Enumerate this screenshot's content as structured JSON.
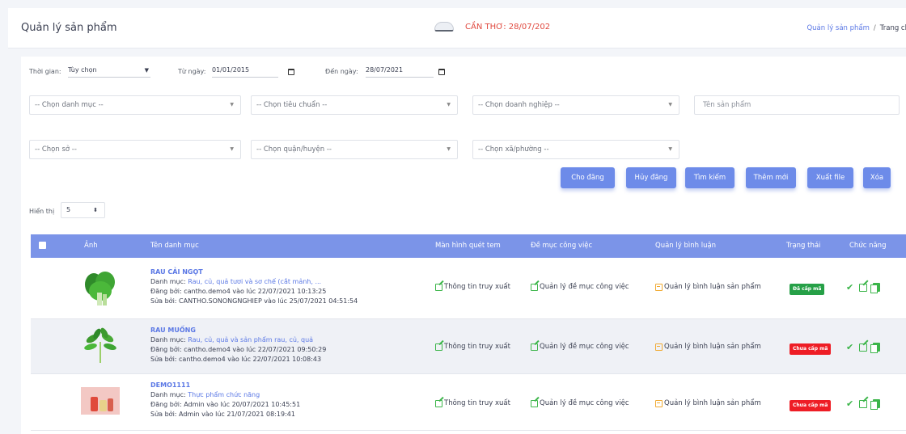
{
  "header": {
    "title": "Quản lý sản phẩm",
    "weather": "CẦN THƠ: 28/07/202",
    "breadcrumb": {
      "current": "Quản lý sản phẩm",
      "separator": "/",
      "home": "Trang ch"
    }
  },
  "filters": {
    "time_label": "Thời gian:",
    "time_value": "Tùy chọn",
    "from_label": "Từ ngày:",
    "from_value": "01/01/2015",
    "to_label": "Đến ngày:",
    "to_value": "28/07/2021",
    "category": "-- Chọn danh mục --",
    "standard": "-- Chọn tiêu chuẩn --",
    "enterprise": "-- Chọn doanh nghiệp --",
    "product_name_placeholder": "Tên sản phẩm",
    "department": "-- Chọn sở --",
    "district": "-- Chọn quận/huyện --",
    "ward": "-- Chọn xã/phường --"
  },
  "actions": {
    "publish": "Cho đăng",
    "unpublish": "Hủy đăng",
    "search": "Tìm kiếm",
    "add": "Thêm mới",
    "export": "Xuất file",
    "delete": "Xóa"
  },
  "pagination": {
    "show_label": "Hiển thị",
    "page_size": "5"
  },
  "table": {
    "columns": [
      "Ảnh",
      "Tên danh mục",
      "Màn hình quét tem",
      "Đề mục công việc",
      "Quản lý bình luận",
      "Trạng thái",
      "Chức năng"
    ],
    "rows": [
      {
        "name": "RAU CẢI NGỌT",
        "category_label": "Danh mục:",
        "category": "Rau, củ, quả tươi và sơ chế (cắt mảnh, ...",
        "posted": "Đăng bởi: cantho.demo4 vào lúc 22/07/2021 10:13:25",
        "edited": "Sửa bởi: CANTHO.SONONGNGHIEP vào lúc 25/07/2021 04:51:54",
        "scan": "Thông tin truy xuất",
        "task": "Quản lý đề mục công việc",
        "comment": "Quản lý bình luận sản phẩm",
        "status": "Đã cấp mã",
        "status_color": "#26a047"
      },
      {
        "name": "RAU MUỐNG",
        "category_label": "Danh mục:",
        "category": "Rau, củ, quả và sản phẩm rau, củ, quả",
        "posted": "Đăng bởi: cantho.demo4 vào lúc 22/07/2021 09:50:29",
        "edited": "Sửa bởi: cantho.demo4 vào lúc 22/07/2021 10:08:43",
        "scan": "Thông tin truy xuất",
        "task": "Quản lý đề mục công việc",
        "comment": "Quản lý bình luận sản phẩm",
        "status": "Chưa cấp mã",
        "status_color": "#ee1d25"
      },
      {
        "name": "DEMO1111",
        "category_label": "Danh mục:",
        "category": "Thực phẩm chức năng",
        "posted": "Đăng bởi: Admin vào lúc 20/07/2021 10:45:51",
        "edited": "Sửa bởi: Admin vào lúc 21/07/2021 08:19:41",
        "scan": "Thông tin truy xuất",
        "task": "Quản lý đề mục công việc",
        "comment": "Quản lý bình luận sản phẩm",
        "status": "Chưa cấp mã",
        "status_color": "#ee1d25"
      }
    ]
  }
}
